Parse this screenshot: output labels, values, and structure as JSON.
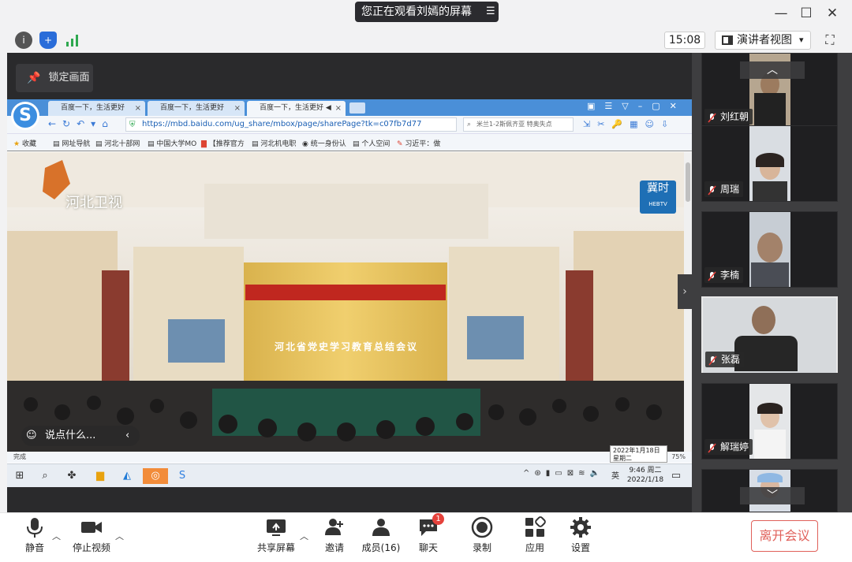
{
  "banner": {
    "text": "您正在观看刘嫣的屏幕",
    "menu_icon": "list-icon"
  },
  "window": {
    "minimize": "—",
    "maximize": "☐",
    "close": "✕"
  },
  "toolbar": {
    "clock": "15:08",
    "view_label": "演讲者视图",
    "view_caret": "▾"
  },
  "stage": {
    "lock_label": "锁定画面"
  },
  "browser": {
    "tabs": [
      {
        "label": "百度一下，生活更好",
        "close": "×"
      },
      {
        "label": "百度一下，生活更好",
        "close": "×"
      },
      {
        "label": "百度一下，生活更好 ◀",
        "close": "×"
      }
    ],
    "url": "https://mbd.baidu.com/ug_share/mbox/page/sharePage?tk=c07fb7d77",
    "search_text": "米兰1-2斯佩齐亚 特奥失点",
    "bookmarks": [
      "收藏",
      "网址导航",
      "河北十部网",
      "中国大学MO",
      "【推荐官方",
      "河北机电职",
      "统一身份认",
      "个人空间",
      "习近平：做"
    ],
    "status": "完成",
    "zoom": "75%"
  },
  "video": {
    "channel_logo": "河北卫视",
    "corner_logo": "冀时",
    "corner_logo_sub": "HEBTV",
    "banner_text": "河北省党史学习教育总结会议",
    "comment_placeholder": "说点什么..."
  },
  "taskbar": {
    "tooltip_date": "2022年1月18日",
    "tooltip_day": "星期二",
    "time": "9:46 周二",
    "date": "2022/1/18",
    "ime": "英"
  },
  "participants": [
    {
      "name": "刘红朝"
    },
    {
      "name": "周瑞"
    },
    {
      "name": "李楠"
    },
    {
      "name": "张磊"
    },
    {
      "name": "解瑞婷"
    }
  ],
  "bottom": {
    "mute": "静音",
    "stop_video": "停止视频",
    "share": "共享屏幕",
    "invite": "邀请",
    "members": "成员(16)",
    "chat": "聊天",
    "chat_badge": "1",
    "record": "录制",
    "apps": "应用",
    "settings": "设置",
    "leave": "离开会议"
  },
  "colors": {
    "accent_red": "#e0605a",
    "badge": "#e5413b",
    "banner_bg": "#2b2b2f",
    "tab_blue": "#4a8fd8"
  }
}
